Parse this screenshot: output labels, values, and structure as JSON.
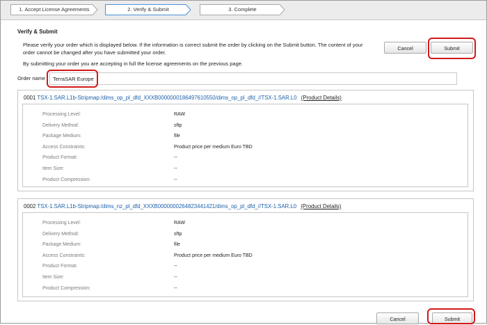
{
  "wizard": {
    "steps": [
      {
        "label": "1. Accept License Agreements"
      },
      {
        "label": "2. Verify & Submit"
      },
      {
        "label": "3. Complete"
      }
    ]
  },
  "verify": {
    "title": "Verify & Submit",
    "instructions": "Please verify your order which is displayed below. If the information is correct submit the order by clicking on the Submit button. The content of your order cannot be changed after you have submitted your order.",
    "license_note": "By submitting your order you are accepting in full the license agreements on the previous page.",
    "cancel_label": "Cancel",
    "submit_label": "Submit"
  },
  "order": {
    "name_label": "Order name :",
    "name_value": "TerraSAR Europe"
  },
  "items": [
    {
      "number": "0001",
      "link": "TSX-1.SAR.L1b-Stripmap:/dims_op_pl_dfd_XXXB0000000186497610550/dims_op_pl_dfd_//TSX-1.SAR.L0",
      "details_label": "(Product Details)",
      "fields": [
        {
          "label": "Processing Level:",
          "value": "RAW"
        },
        {
          "label": "Delivery Method:",
          "value": "sftp"
        },
        {
          "label": "Package Medium:",
          "value": "file"
        },
        {
          "label": "Access Constraints:",
          "value": "Product price per medium Euro TBD"
        },
        {
          "label": "Product Format:",
          "value": "--"
        },
        {
          "label": "Item Size:",
          "value": "--"
        },
        {
          "label": "Product Compression:",
          "value": "--"
        }
      ]
    },
    {
      "number": "0002",
      "link": "TSX-1.SAR.L1b-Stripmap:/dims_nz_pl_dfd_XXXB0000000264823441421/dims_op_pl_dfd_//TSX-1.SAR.L0",
      "details_label": "(Product Details)",
      "fields": [
        {
          "label": "Processing Level:",
          "value": "RAW"
        },
        {
          "label": "Delivery Method:",
          "value": "sftp"
        },
        {
          "label": "Package Medium:",
          "value": "file"
        },
        {
          "label": "Access Constraints:",
          "value": "Product price per medium Euro TBD"
        },
        {
          "label": "Product Format:",
          "value": "--"
        },
        {
          "label": "Item Size:",
          "value": "--"
        },
        {
          "label": "Product Compression:",
          "value": "--"
        }
      ]
    }
  ]
}
